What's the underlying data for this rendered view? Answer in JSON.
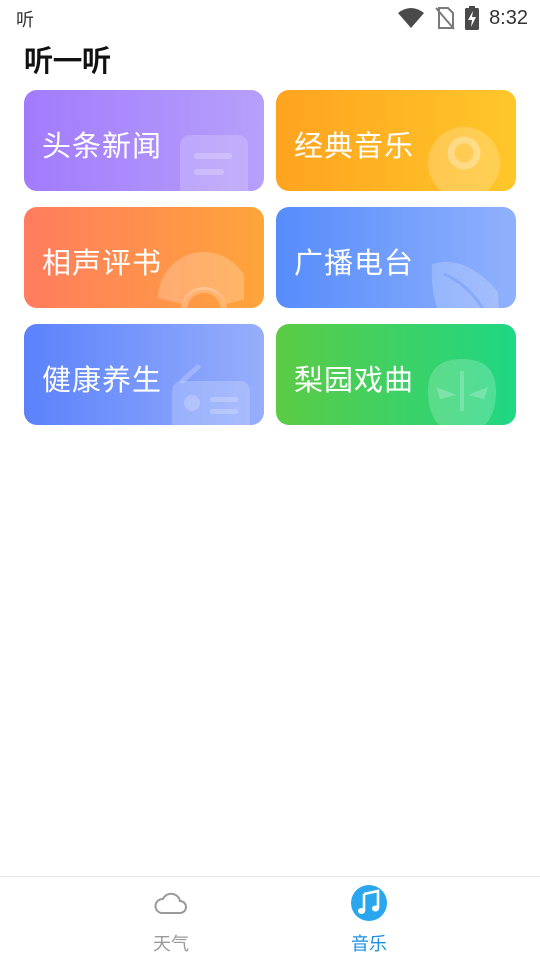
{
  "status_bar": {
    "app_label": "听",
    "time": "8:32",
    "icons": [
      "wifi-icon",
      "no-sim-icon",
      "battery-charging-icon"
    ]
  },
  "page": {
    "title": "听一听"
  },
  "categories": [
    {
      "label": "头条新闻",
      "icon": "newspaper-icon",
      "gradient": [
        "#a27bfc",
        "#b6a0fb"
      ]
    },
    {
      "label": "经典音乐",
      "icon": "vinyl-record-icon",
      "gradient": [
        "#ffa31f",
        "#ffc72a"
      ]
    },
    {
      "label": "相声评书",
      "icon": "folding-fan-icon",
      "gradient": [
        "#ff7c5f",
        "#ffa53a"
      ]
    },
    {
      "label": "广播电台",
      "icon": "leaf-icon",
      "gradient": [
        "#568cfb",
        "#90b1fc"
      ]
    },
    {
      "label": "健康养生",
      "icon": "radio-icon",
      "gradient": [
        "#5b82fb",
        "#97aefc"
      ]
    },
    {
      "label": "梨园戏曲",
      "icon": "opera-mask-icon",
      "gradient": [
        "#5ccb45",
        "#1fd784"
      ]
    }
  ],
  "bottom_nav": {
    "items": [
      {
        "label": "天气",
        "icon": "cloud-icon",
        "active": false
      },
      {
        "label": "音乐",
        "icon": "music-note-icon",
        "active": true
      }
    ],
    "active_color": "#1a8fe0",
    "inactive_color": "#9a9a9a"
  }
}
